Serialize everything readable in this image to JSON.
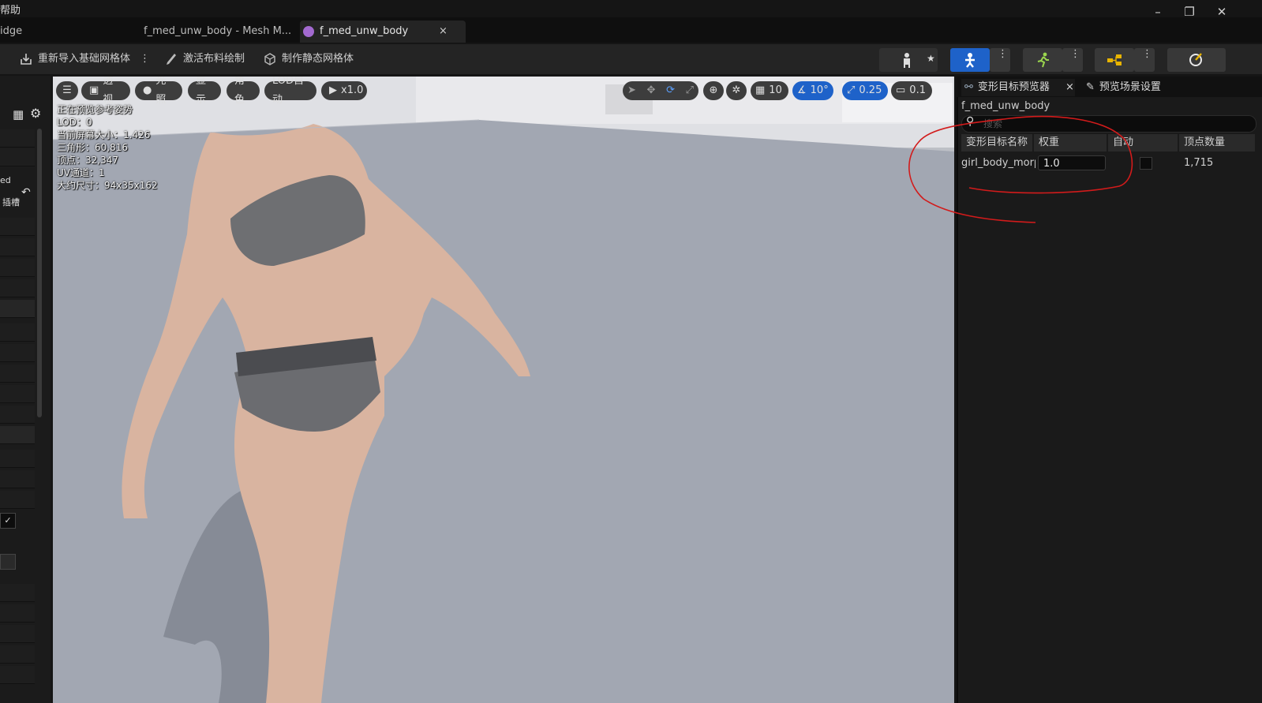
{
  "menu": {
    "help": "帮助"
  },
  "window": {
    "minimize": "–",
    "restore": "❐",
    "close": "✕"
  },
  "tabs": [
    {
      "label": "idge"
    },
    {
      "label": "f_med_unw_body - Mesh M..."
    },
    {
      "label": "f_med_unw_body",
      "close": "×"
    }
  ],
  "toolbar": {
    "reimport": "重新导入基础网格体",
    "cloth": "激活布料绘制",
    "static": "制作静态网格体"
  },
  "left_panel": {
    "tag1": "ed",
    "tag2": "插槽"
  },
  "viewport": {
    "pills": {
      "perspective": "透视",
      "lighting": "光照",
      "show": "显示",
      "character": "角色",
      "lod": "LOD自动",
      "speed": "x1.0",
      "grid": "10",
      "angle": "10°",
      "scale": "0.25",
      "camera": "0.1"
    },
    "stats": [
      "正在预览参考姿势",
      "LOD：0",
      "当前屏幕大小：1.426",
      "三角形：60,816",
      "顶点：32,347",
      "UV通道：1",
      "大约尺寸：94x35x162"
    ]
  },
  "right_panel": {
    "tab_morph": "变形目标预览器",
    "tab_close": "×",
    "tab_scene": "预览场景设置",
    "asset": "f_med_unw_body",
    "search_placeholder": "搜索",
    "columns": [
      "变形目标名称",
      "权重",
      "自动",
      "顶点数量"
    ],
    "row": {
      "name": "girl_body_morph",
      "weight": "1.0",
      "auto": false,
      "vertices": "1,715"
    }
  },
  "colors": {
    "accent_blue": "#1e62c9",
    "annotation_red": "#d21b1b"
  }
}
